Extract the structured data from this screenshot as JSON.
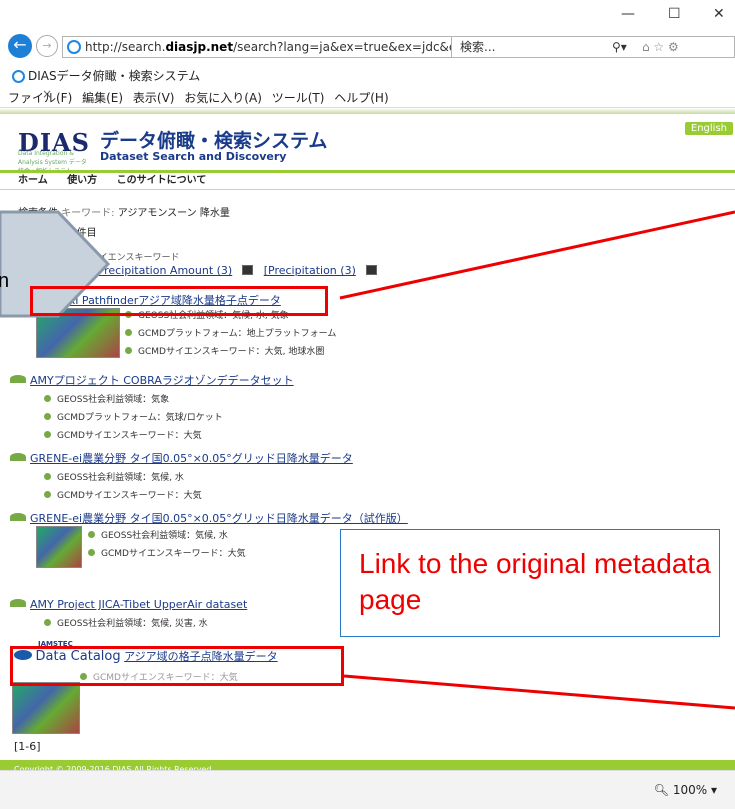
{
  "browser": {
    "url_prefix": "http://search.",
    "url_domain": "diasjp.net",
    "url_rest": "/search?lang=ja&ex=true&ex=jdc&e",
    "search_placeholder": "検索...",
    "tab_title": "DIASデータ俯瞰・検索システム",
    "menu": [
      "ファイル(F)",
      "編集(E)",
      "表示(V)",
      "お気に入り(A)",
      "ツール(T)",
      "ヘルプ(H)"
    ],
    "zoom": "100%"
  },
  "site": {
    "logo": "DIAS",
    "logo_sub": "Data Integration & Analysis System データ統合・解析システム",
    "title": "データ俯瞰・検索システム",
    "subtitle": "Dataset Search and Discovery",
    "english_label": "English",
    "nav": [
      "ホーム",
      "使い方",
      "このサイトについて"
    ]
  },
  "search": {
    "condition_label": "検索条件",
    "keyword_label": "キーワード:",
    "keyword": "アジアモンスーン 降水量",
    "count": "6 件中 1 - 6 件目",
    "refine_label": "み検索 by GCMDサイエンスキーワード",
    "refine_links": [
      "here (4)",
      "[Precipitation Amount (3)",
      "[Precipitation (3)"
    ]
  },
  "results": [
    {
      "title": "IAHASRI Pathfinderアジア域降水量格子点データ",
      "meta": [
        "GEOSS社会利益領域：気候, 水, 気象",
        "GCMDプラットフォーム：地上プラットフォーム",
        "GCMDサイエンスキーワード：大気, 地球水圏"
      ]
    },
    {
      "title": "AMYプロジェクト COBRAラジオゾンデデータセット",
      "meta": [
        "GEOSS社会利益領域：気象",
        "GCMDプラットフォーム：気球/ロケット",
        "GCMDサイエンスキーワード：大気"
      ]
    },
    {
      "title": "GRENE-ei農業分野 タイ国0.05°×0.05°グリッド日降水量データ",
      "meta": [
        "GEOSS社会利益領域：気候, 水",
        "GCMDサイエンスキーワード：大気"
      ]
    },
    {
      "title": "GRENE-ei農業分野 タイ国0.05°×0.05°グリッド日降水量データ（試作版）",
      "meta": [
        "GEOSS社会利益領域：気候, 水",
        "GCMDサイエンスキーワード：大気"
      ]
    },
    {
      "title": "AMY Project JICA-Tibet UpperAir dataset",
      "meta": [
        "GEOSS社会利益領域：気候, 災害, 水"
      ]
    },
    {
      "title": "アジア域の格子点降水量データ",
      "catalog_label": "Data Catalog",
      "catalog_org": "JAMSTEC",
      "meta": [
        "GCMDサイエンスキーワード：大気"
      ]
    }
  ],
  "paging": "[1-6]",
  "footer": "Copyright © 2009-2016 DIAS All Rights Reserved.",
  "overlay": {
    "callout_text": "n",
    "annotation": "Link to the original metadata page"
  },
  "colors": {
    "accent": "#99cc33",
    "highlight": "#ee0000",
    "link": "#1a3a8a"
  }
}
